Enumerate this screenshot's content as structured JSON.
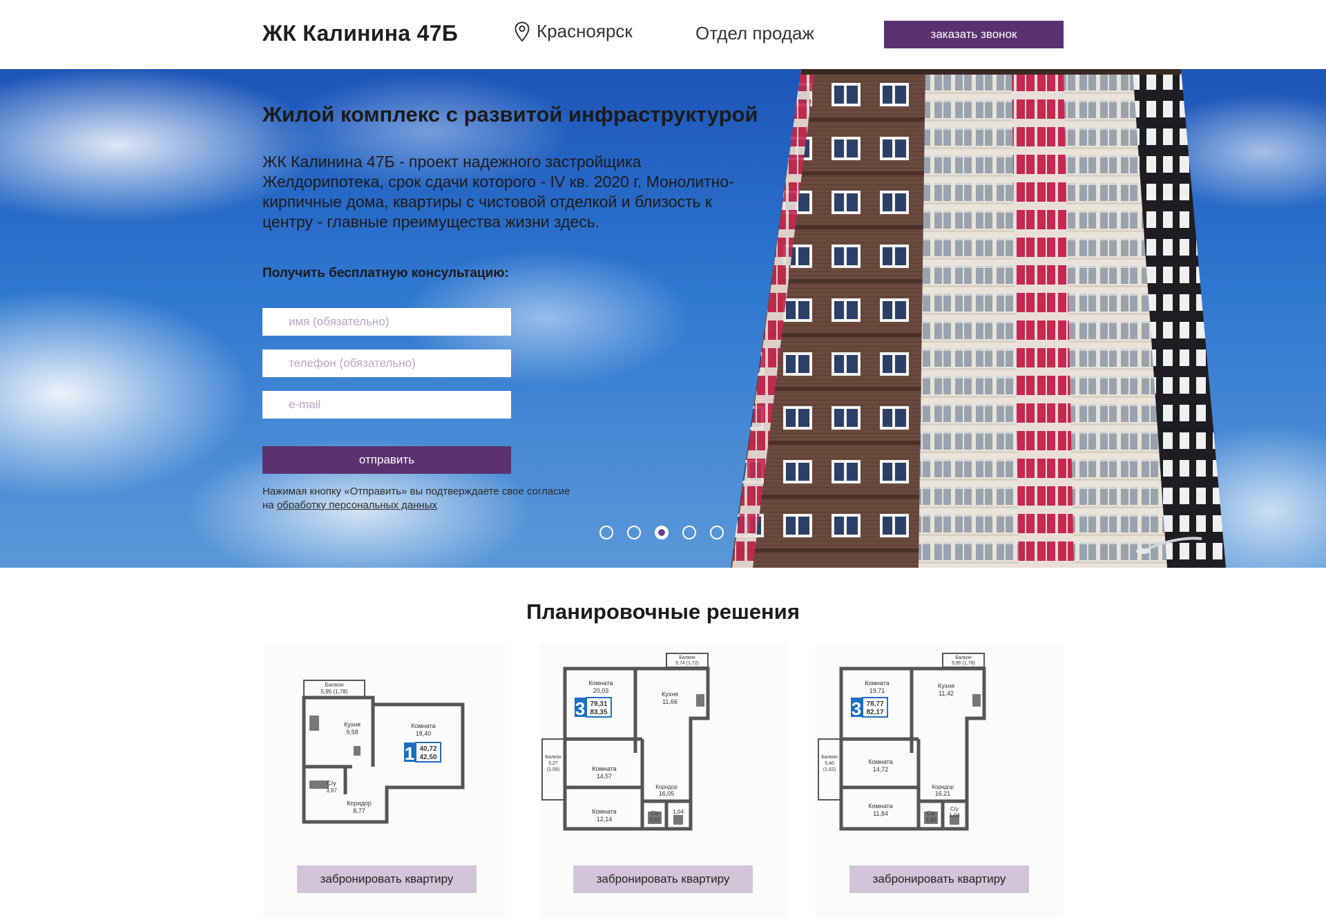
{
  "header": {
    "logo": "ЖК Калинина 47Б",
    "city": "Красноярск",
    "sales": "Отдел продаж",
    "callback_label": "заказать звонок"
  },
  "hero": {
    "title": "Жилой комплекс с развитой инфраструктурой",
    "description": "ЖК Калинина 47Б - проект надежного застройщика Желдорипотека, срок сдачи которого - IV кв. 2020 г. Монолитно-кирпичные дома, квартиры с чистовой отделкой и близость к центру - главные преимущества жизни здесь.",
    "consult_label": "Получить бесплатную консультацию:",
    "name_placeholder": "имя (обязательно)",
    "phone_placeholder": "телефон (обязательно)",
    "email_placeholder": "e-mail",
    "send_label": "отправить",
    "consent_text": "Нажимая кнопку «Отправить» вы подтверждаете свое согласие на",
    "consent_link": "обработку персональных данных",
    "slides": 5,
    "active_slide": 3
  },
  "plans": {
    "title": "Планировочные решения",
    "items": [
      {
        "rooms": "1",
        "area_living": "40,72",
        "area_total": "42,50",
        "balcony": "Балкон",
        "balcony_area": "5,95 (1,78)",
        "kitchen": "Кухня",
        "kitchen_area": "9,58",
        "room": "Комната",
        "room_area": "18,40",
        "bath": "С/у",
        "bath_area": "3,97",
        "corridor": "Коридор",
        "corridor_area": "8,77",
        "book_label": "забронировать квартиру"
      },
      {
        "rooms": "3",
        "area_living": "79,31",
        "area_total": "83,35",
        "balcony": "Балкон",
        "balcony_area": "5,74 (1,72)",
        "side_balcony": "Балкон",
        "side_balcony_area": "5,27",
        "side_balcony_area2": "(1,58)",
        "room1": "Комната",
        "room1_area": "20,03",
        "kitchen": "Кухня",
        "kitchen_area": "11,66",
        "room2": "Комната",
        "room2_area": "14,57",
        "corridor": "Коридор",
        "corridor_area": "16,05",
        "room3": "Комната",
        "room3_area": "12,14",
        "bath": "С/у",
        "bath_area": "3,82",
        "wc_area": "1,04",
        "book_label": "забронировать квартиру"
      },
      {
        "rooms": "3",
        "area_living": "78,77",
        "area_total": "82,17",
        "balcony": "Балкон",
        "balcony_area": "5,95 (1,78)",
        "side_balcony": "Балкон",
        "side_balcony_area": "5,40",
        "side_balcony_area2": "(1,62)",
        "room1": "Комната",
        "room1_area": "19,71",
        "kitchen": "Кухня",
        "kitchen_area": "11,42",
        "room2": "Комната",
        "room2_area": "14,72",
        "corridor": "Коридор",
        "corridor_area": "16,21",
        "room3": "Комната",
        "room3_area": "11,84",
        "bath": "С/у",
        "bath_area": "3,83",
        "wc": "С/у",
        "wc_area": "1,04",
        "book_label": "забронировать квартиру"
      }
    ]
  },
  "colors": {
    "brand_purple": "#5a3270",
    "book_button": "#d3c4d9",
    "accent_blue": "#1a6fc4"
  },
  "icons": {
    "city": "map-pin-icon"
  }
}
